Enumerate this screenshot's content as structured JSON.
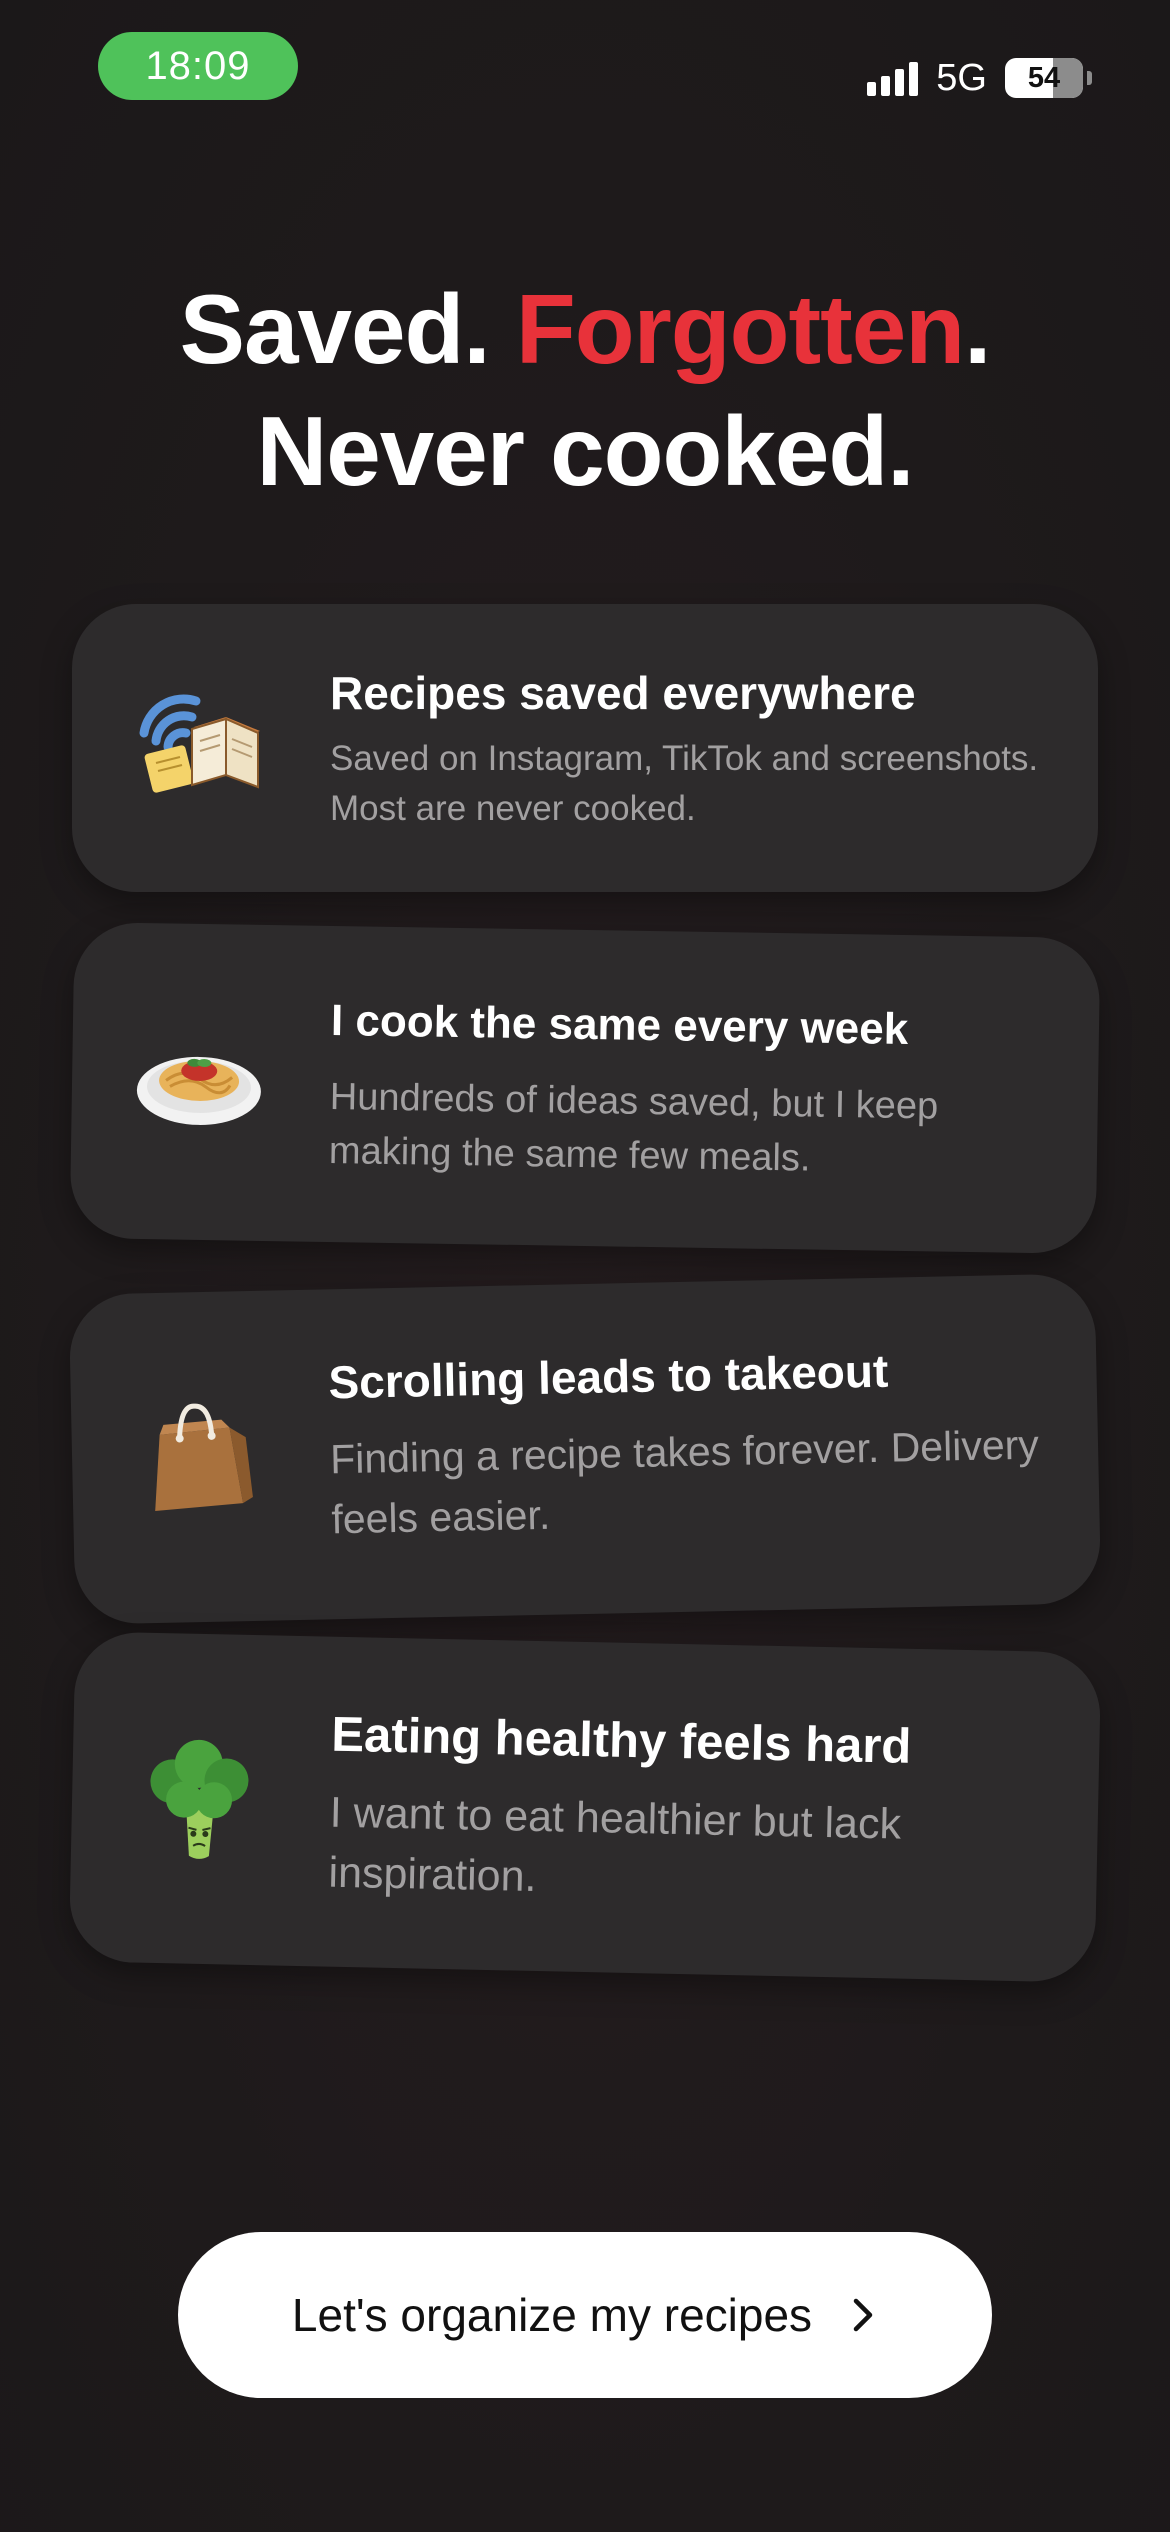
{
  "status_bar": {
    "time": "18:09",
    "network": "5G",
    "battery": "54",
    "colors": {
      "time_pill": "#4fc25a"
    }
  },
  "headline": {
    "part1": "Saved.",
    "accent": "Forgotten",
    "part2": ".",
    "line2": "Never cooked.",
    "accent_color": "#e8323a"
  },
  "cards": [
    {
      "icon": "saved-recipes-icon",
      "title": "Recipes saved everywhere",
      "description": "Saved on Instagram, TikTok and screenshots. Most are never cooked."
    },
    {
      "icon": "spaghetti-icon",
      "title": "I cook the same every week",
      "description": "Hundreds of ideas saved, but I keep making the same few meals."
    },
    {
      "icon": "takeout-bag-icon",
      "title": "Scrolling leads to takeout",
      "description": "Finding a recipe takes forever. Delivery feels easier."
    },
    {
      "icon": "broccoli-icon",
      "title": "Eating healthy feels hard",
      "description": "I want to eat healthier but lack inspiration."
    }
  ],
  "cta": {
    "label": "Let's organize my recipes",
    "icon": "chevron-right-icon"
  }
}
